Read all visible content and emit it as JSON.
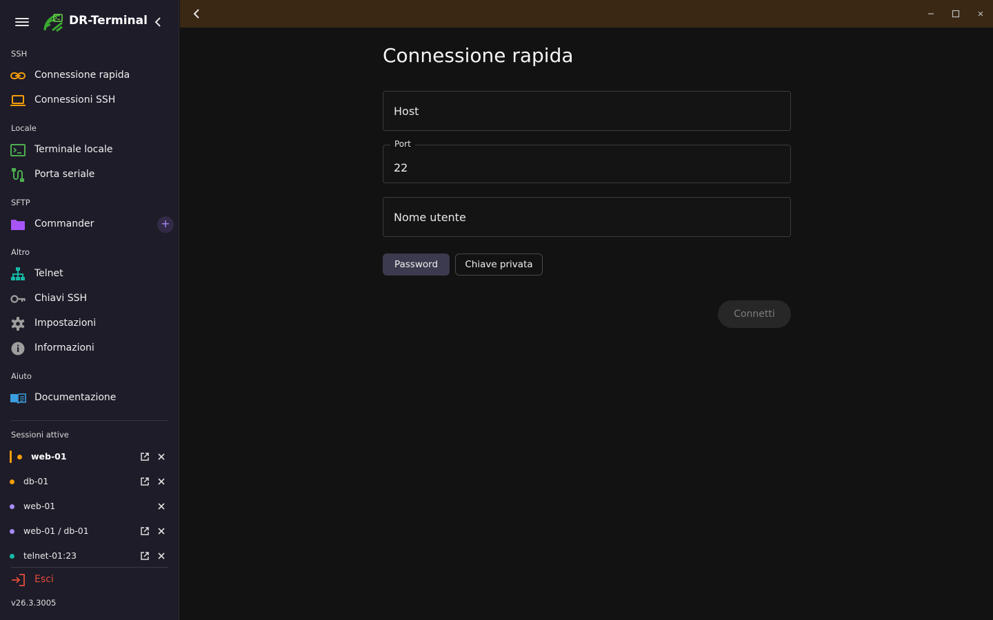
{
  "app": {
    "title": "DR-Terminal",
    "version": "v26.3.3005"
  },
  "colors": {
    "sidebar_bg": "#1e1c28",
    "titlebar_bg": "#3a2815",
    "main_bg": "#121212",
    "accent_orange": "#f59e0b",
    "accent_purple": "#a78bfa",
    "accent_teal": "#14b8a6",
    "accent_green": "#4caf50",
    "danger_red": "#e74c3c"
  },
  "sidebar": {
    "sections": {
      "ssh": "SSH",
      "local": "Locale",
      "sftp": "SFTP",
      "other": "Altro",
      "help": "Aiuto",
      "active_sessions": "Sessioni attive"
    },
    "items": {
      "quick_connect": {
        "label": "Connessione rapida",
        "icon": "link-icon"
      },
      "ssh_connections": {
        "label": "Connessioni SSH",
        "icon": "laptop-icon"
      },
      "local_terminal": {
        "label": "Terminale locale",
        "icon": "terminal-icon"
      },
      "serial_port": {
        "label": "Porta seriale",
        "icon": "serial-cable-icon"
      },
      "commander": {
        "label": "Commander",
        "icon": "folder-icon",
        "add": "+"
      },
      "telnet": {
        "label": "Telnet",
        "icon": "network-icon"
      },
      "ssh_keys": {
        "label": "Chiavi SSH",
        "icon": "key-icon"
      },
      "settings": {
        "label": "Impostazioni",
        "icon": "gear-icon"
      },
      "info": {
        "label": "Informazioni",
        "icon": "info-icon"
      },
      "docs": {
        "label": "Documentazione",
        "icon": "book-icon"
      }
    },
    "sessions": [
      {
        "name": "web-01",
        "color": "#f59e0b",
        "active": true,
        "detachable": true
      },
      {
        "name": "db-01",
        "color": "#f59e0b",
        "active": false,
        "detachable": true
      },
      {
        "name": "web-01",
        "color": "#a78bfa",
        "active": false,
        "detachable": false
      },
      {
        "name": "web-01 / db-01",
        "color": "#a78bfa",
        "active": false,
        "detachable": true
      },
      {
        "name": "telnet-01:23",
        "color": "#14b8a6",
        "active": false,
        "detachable": true
      }
    ],
    "exit_label": "Esci"
  },
  "main": {
    "title": "Connessione rapida",
    "host": {
      "placeholder": "Host",
      "value": ""
    },
    "port": {
      "label": "Port",
      "value": "22"
    },
    "username": {
      "placeholder": "Nome utente",
      "value": ""
    },
    "auth": {
      "password": "Password",
      "private_key": "Chiave privata",
      "selected": "Password"
    },
    "connect": "Connetti"
  }
}
